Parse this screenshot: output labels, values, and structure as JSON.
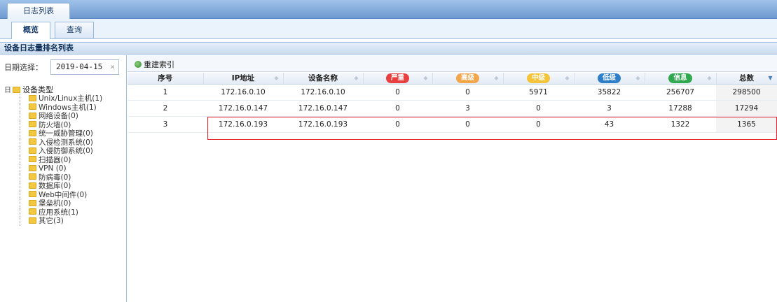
{
  "top_tab": "日志列表",
  "sub_tabs": [
    {
      "label": "概览",
      "active": true
    },
    {
      "label": "查询",
      "active": false
    }
  ],
  "section_title": "设备日志量排名列表",
  "date": {
    "label": "日期选择：",
    "value": "2019-04-15",
    "clear": "×"
  },
  "tree": {
    "toggle": "日",
    "root": "设备类型",
    "items": [
      "Unix/Linux主机(1)",
      "Windows主机(1)",
      "网络设备(0)",
      "防火墙(0)",
      "统一威胁管理(0)",
      "入侵检测系统(0)",
      "入侵防御系统(0)",
      "扫描器(0)",
      "VPN (0)",
      "防病毒(0)",
      "数据库(0)",
      "Web中间件(0)",
      "堡垒机(0)",
      "应用系统(1)",
      "其它(3)"
    ]
  },
  "toolbar": {
    "rebuild_label": "重建索引"
  },
  "table": {
    "headers": {
      "seq": "序号",
      "ip": "IP地址",
      "name": "设备名称",
      "severe": "严重",
      "high": "高级",
      "mid": "中级",
      "low": "低级",
      "info": "信息",
      "total": "总数"
    },
    "badge_colors": {
      "severe": "#e8403e",
      "high": "#f3a64a",
      "mid": "#f6c43a",
      "low": "#2f7fc8",
      "info": "#2fa84f"
    },
    "rows": [
      {
        "seq": "1",
        "ip": "172.16.0.10",
        "name": "172.16.0.10",
        "severe": "0",
        "high": "0",
        "mid": "5971",
        "low": "35822",
        "info": "256707",
        "total": "298500"
      },
      {
        "seq": "2",
        "ip": "172.16.0.147",
        "name": "172.16.0.147",
        "severe": "0",
        "high": "3",
        "mid": "0",
        "low": "3",
        "info": "17288",
        "total": "17294"
      },
      {
        "seq": "3",
        "ip": "172.16.0.193",
        "name": "172.16.0.193",
        "severe": "0",
        "high": "0",
        "mid": "0",
        "low": "43",
        "info": "1322",
        "total": "1365"
      }
    ]
  }
}
